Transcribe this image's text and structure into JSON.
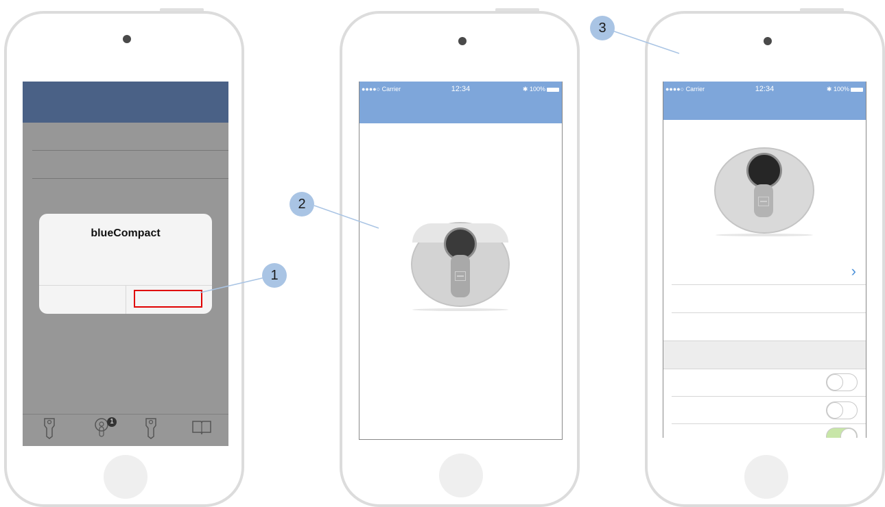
{
  "dialog": {
    "title": "blueCompact"
  },
  "status_bar": {
    "carrier": "●●●●○ Carrier",
    "time": "12:34",
    "battery": "100%"
  },
  "callouts": [
    "1",
    "2",
    "3"
  ],
  "screen3": {
    "chevron": "›",
    "toggles": [
      {
        "on": false
      },
      {
        "on": false
      },
      {
        "on": true
      }
    ]
  },
  "icons": {
    "tabbar": [
      "key-icon",
      "lock-cylinder-icon",
      "key-icon",
      "book-icon"
    ],
    "badge": "1"
  },
  "colors": {
    "navbar_dark": "#4a6186",
    "navbar_light": "#7ea6da",
    "overlay_gray": "#979797",
    "callout_blue": "#a9c4e4",
    "highlight_red": "#e00000",
    "toggle_on": "#c8e6a8"
  }
}
